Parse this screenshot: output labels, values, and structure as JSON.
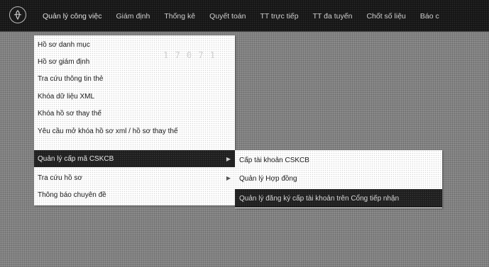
{
  "nav": {
    "logo_icon": "seal-icon",
    "items": [
      {
        "label": "Quản lý công việc"
      },
      {
        "label": "Giám định"
      },
      {
        "label": "Thống kê"
      },
      {
        "label": "Quyết toán"
      },
      {
        "label": "TT trực tiếp"
      },
      {
        "label": "TT đa tuyến"
      },
      {
        "label": "Chốt số liệu"
      },
      {
        "label": "Báo c"
      }
    ]
  },
  "main_menu": {
    "items": [
      {
        "label": "Hồ sơ danh mục"
      },
      {
        "label": "Hồ sơ giám định"
      },
      {
        "label": "Tra cứu thông tin thẻ"
      },
      {
        "label": "Khóa dữ liệu XML"
      },
      {
        "label": "Khóa hồ sơ thay thế"
      },
      {
        "label": "Yêu cầu mở khóa hồ sơ xml / hồ sơ thay thế"
      },
      {
        "label": "Quản lý cấp mã CSKCB",
        "submenu": true
      },
      {
        "label": "Tra cứu hồ sơ",
        "submenu": true
      },
      {
        "label": "Thông báo chuyên đề"
      }
    ],
    "faint_text": "1 7 0 7 1"
  },
  "sub_menu": {
    "items": [
      {
        "label": "Cấp tài khoản CSKCB"
      },
      {
        "label": "Quản lý Hợp đồng"
      },
      {
        "label": "Quản lý đăng ký cấp tài khoản trên Cổng tiếp nhận"
      }
    ]
  },
  "colors": {
    "topbar": "#151515",
    "highlight": "#1e1e1e",
    "menu_bg": "#ffffff",
    "page_bg": "#8a8a8a"
  }
}
